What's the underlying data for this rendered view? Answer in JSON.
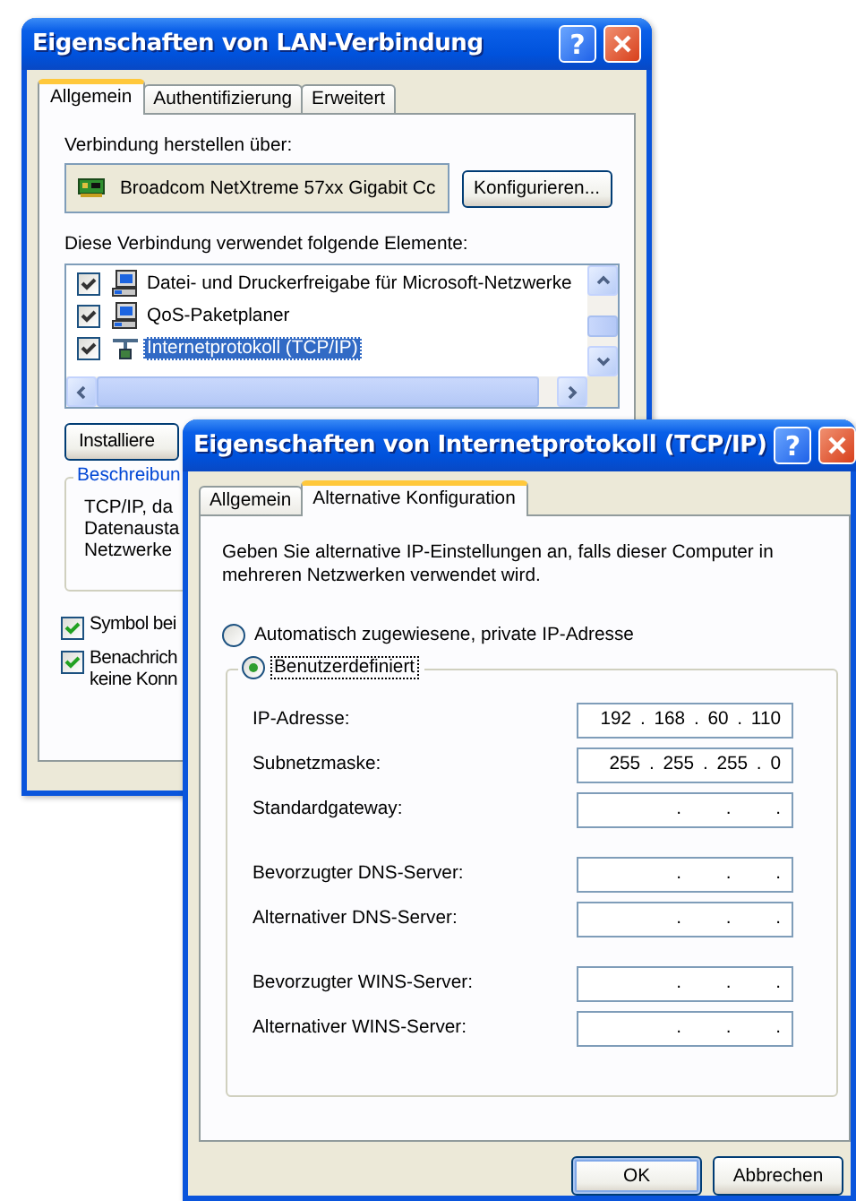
{
  "lan_dialog": {
    "title": "Eigenschaften von LAN-Verbindung",
    "help": "?",
    "tabs": [
      {
        "label": "Allgemein",
        "selected": true
      },
      {
        "label": "Authentifizierung",
        "selected": false
      },
      {
        "label": "Erweitert",
        "selected": false
      }
    ],
    "connect_label": "Verbindung herstellen über:",
    "adapter": "Broadcom NetXtreme 57xx Gigabit Cc",
    "configure_button": "Konfigurieren...",
    "components_label": "Diese Verbindung verwendet folgende Elemente:",
    "components": [
      {
        "kind": "service",
        "label": "Datei- und Druckerfreigabe für Microsoft-Netzwerke",
        "checked": true,
        "selected": false
      },
      {
        "kind": "service",
        "label": "QoS-Paketplaner",
        "checked": true,
        "selected": false
      },
      {
        "kind": "protocol",
        "label": "Internetprotokoll (TCP/IP)",
        "checked": true,
        "selected": true
      }
    ],
    "install_button": "Installiere",
    "description": {
      "legend": "Beschreibun",
      "lines": [
        "TCP/IP, da",
        "Datenausta",
        "Netzwerke"
      ]
    },
    "options": [
      {
        "lines": [
          "Symbol bei"
        ],
        "checked": true
      },
      {
        "lines": [
          "Benachrich",
          "keine Konn"
        ],
        "checked": true
      }
    ]
  },
  "tcpip_dialog": {
    "title": "Eigenschaften von Internetprotokoll (TCP/IP)",
    "help": "?",
    "tabs": [
      {
        "label": "Allgemein",
        "selected": false
      },
      {
        "label": "Alternative Konfiguration",
        "selected": true
      }
    ],
    "intro": "Geben Sie alternative IP-Einstellungen an, falls dieser Computer in mehreren Netzwerken verwendet wird.",
    "modes": [
      {
        "label": "Automatisch zugewiesene, private IP-Adresse",
        "selected": false
      },
      {
        "label": "Benutzerdefiniert",
        "selected": true
      }
    ],
    "field_groups": [
      {
        "fields": [
          {
            "label": "IP-Adresse:",
            "value": "192 . 168 . 60 . 110"
          },
          {
            "label": "Subnetzmaske:",
            "value": "255 . 255 . 255 . 0"
          },
          {
            "label": "Standardgateway:",
            "value": ". . ."
          }
        ]
      },
      {
        "fields": [
          {
            "label": "Bevorzugter DNS-Server:",
            "value": ". . ."
          },
          {
            "label": "Alternativer DNS-Server:",
            "value": ". . ."
          }
        ]
      },
      {
        "fields": [
          {
            "label": "Bevorzugter WINS-Server:",
            "value": ". . ."
          },
          {
            "label": "Alternativer WINS-Server:",
            "value": ". . ."
          }
        ]
      }
    ],
    "buttons": [
      {
        "label": "OK",
        "default": true
      },
      {
        "label": "Abbrechen",
        "default": false
      }
    ]
  }
}
